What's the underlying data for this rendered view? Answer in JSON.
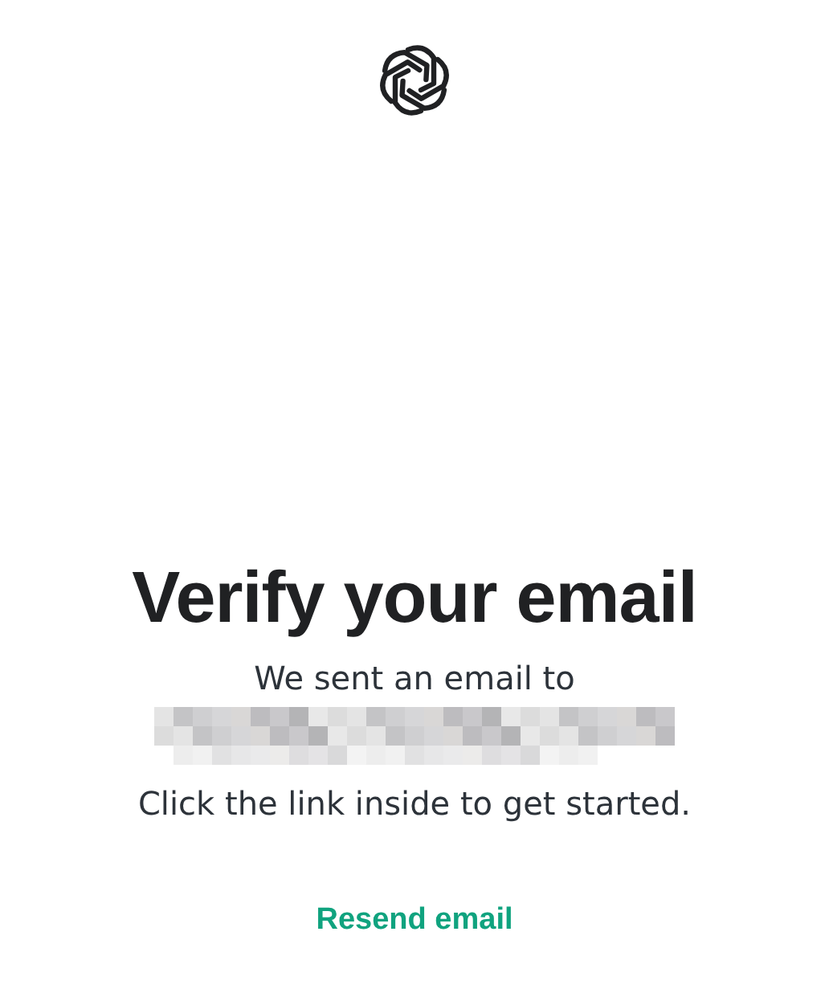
{
  "heading": "Verify your email",
  "message": "We sent an email to",
  "email": {
    "kind": "pixelated"
  },
  "instruction": "Click the link inside to get started.",
  "resend_button": "Resend email"
}
